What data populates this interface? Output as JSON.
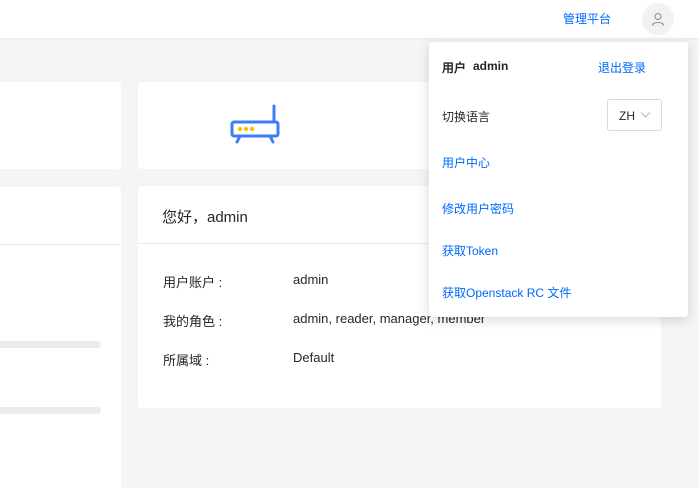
{
  "header": {
    "admin_link": "管理平台",
    "avatar_icon": "user-icon"
  },
  "info_card": {
    "greeting": "您好，admin",
    "rows": [
      {
        "label": "用户账户 :",
        "value": "admin"
      },
      {
        "label": "我的角色 :",
        "value": "admin, reader, manager, member"
      },
      {
        "label": "所属域 :",
        "value": "Default"
      }
    ]
  },
  "top_card": {
    "icon": "router-icon"
  },
  "dropdown": {
    "user_label": "用户",
    "user_name": "admin",
    "logout": "退出登录",
    "lang_label": "切换语言",
    "lang_value": "ZH",
    "links": [
      "用户中心",
      "修改用户密码",
      "获取Token",
      "获取Openstack RC 文件"
    ]
  },
  "colors": {
    "accent": "#0068ff",
    "router_yellow": "#f5c400"
  }
}
